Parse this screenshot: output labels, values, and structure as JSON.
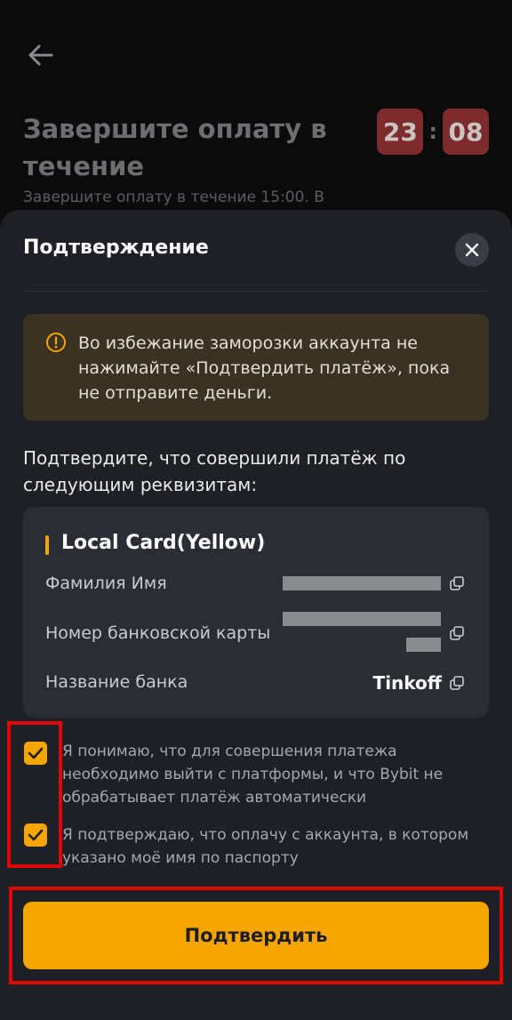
{
  "background": {
    "title": "Завершите оплату в течение",
    "timer": {
      "minutes": "23",
      "separator": ":",
      "seconds": "08"
    },
    "subtitle": "Завершите оплату в течение 15:00. В"
  },
  "sheet": {
    "title": "Подтверждение",
    "warning": "Во избежание заморозки аккаунта не нажимайте «Подтвердить платёж», пока не отправите деньги.",
    "prompt": "Подтвердите, что совершили платёж по следующим реквизитам:",
    "card": {
      "title": "Local Card(Yellow)",
      "rows": [
        {
          "label": "Фамилия Имя"
        },
        {
          "label": "Номер банковской карты"
        },
        {
          "label": "Название банка",
          "value": "Tinkoff"
        }
      ]
    },
    "checkboxes": [
      {
        "text": "Я понимаю, что для совершения платежа необходимо выйти с платформы, и что Bybit не обрабатывает платёж автоматически",
        "checked": true
      },
      {
        "text": "Я подтверждаю, что оплачу с аккаунта, в котором указано моё имя по паспорту",
        "checked": true
      }
    ],
    "confirm_label": "Подтвердить"
  },
  "colors": {
    "accent": "#f7a600",
    "sheet_bg": "#1e2026",
    "highlight": "#e10600"
  },
  "icons": [
    "arrow-left-icon",
    "close-icon",
    "warning-icon",
    "copy-icon",
    "checkmark-icon"
  ]
}
